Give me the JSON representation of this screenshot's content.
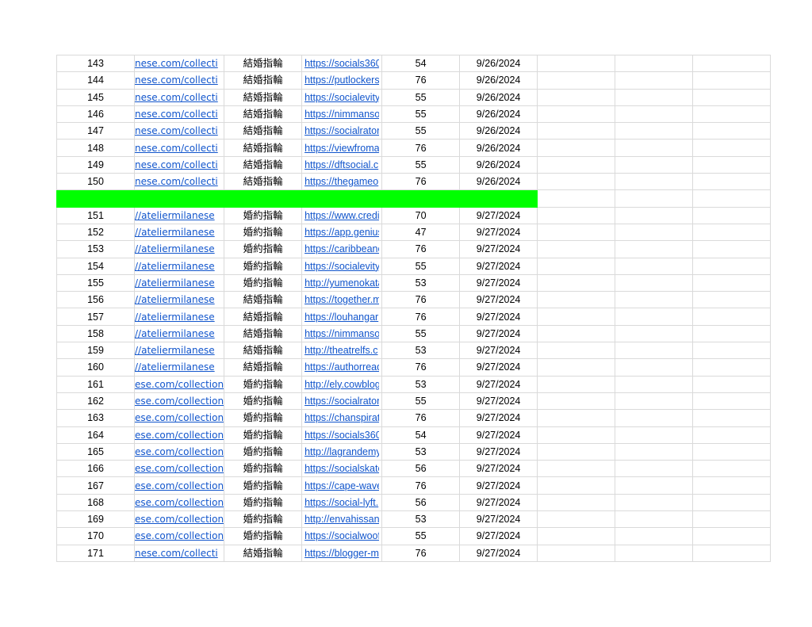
{
  "rows": [
    {
      "num": "143",
      "src": "nese.com/collecti",
      "kw": "結婚指輪",
      "url": "https://socials360",
      "da": "54",
      "date": "9/26/2024"
    },
    {
      "num": "144",
      "src": "nese.com/collecti",
      "kw": "結婚指輪",
      "url": "https://putlockers",
      "da": "76",
      "date": "9/26/2024"
    },
    {
      "num": "145",
      "src": "nese.com/collecti",
      "kw": "結婚指輪",
      "url": "https://socialevity",
      "da": "55",
      "date": "9/26/2024"
    },
    {
      "num": "146",
      "src": "nese.com/collecti",
      "kw": "結婚指輪",
      "url": "https://nimmanso",
      "da": "55",
      "date": "9/26/2024"
    },
    {
      "num": "147",
      "src": "nese.com/collecti",
      "kw": "結婚指輪",
      "url": "https://socialrator",
      "da": "55",
      "date": "9/26/2024"
    },
    {
      "num": "148",
      "src": "nese.com/collecti",
      "kw": "結婚指輪",
      "url": "https://viewfroma",
      "da": "76",
      "date": "9/26/2024"
    },
    {
      "num": "149",
      "src": "nese.com/collecti",
      "kw": "結婚指輪",
      "url": "https://dftsocial.c",
      "da": "55",
      "date": "9/26/2024"
    },
    {
      "num": "150",
      "src": "nese.com/collecti",
      "kw": "結婚指輪",
      "url": "https://thegameo",
      "da": "76",
      "date": "9/26/2024"
    },
    {
      "separator": true
    },
    {
      "num": "151",
      "src": "//ateliermilanese",
      "kw": "婚約指輪",
      "url": "https://www.credi",
      "da": "70",
      "date": "9/27/2024"
    },
    {
      "num": "152",
      "src": "//ateliermilanese",
      "kw": "婚約指輪",
      "url": "https://app.genius",
      "da": "47",
      "date": "9/27/2024"
    },
    {
      "num": "153",
      "src": "//ateliermilanese",
      "kw": "婚約指輪",
      "url": "https://caribbeanc",
      "da": "76",
      "date": "9/27/2024"
    },
    {
      "num": "154",
      "src": "//ateliermilanese",
      "kw": "婚約指輪",
      "url": "https://socialevity",
      "da": "55",
      "date": "9/27/2024"
    },
    {
      "num": "155",
      "src": "//ateliermilanese",
      "kw": "婚約指輪",
      "url": "http://yumenokata",
      "da": "53",
      "date": "9/27/2024"
    },
    {
      "num": "156",
      "src": "//ateliermilanese",
      "kw": "結婚指輪",
      "url": "https://together.m",
      "da": "76",
      "date": "9/27/2024"
    },
    {
      "num": "157",
      "src": "//ateliermilanese",
      "kw": "結婚指輪",
      "url": "https://louhangar",
      "da": "76",
      "date": "9/27/2024"
    },
    {
      "num": "158",
      "src": "//ateliermilanese",
      "kw": "結婚指輪",
      "url": "https://nimmanso",
      "da": "55",
      "date": "9/27/2024"
    },
    {
      "num": "159",
      "src": "//ateliermilanese",
      "kw": "結婚指輪",
      "url": "http://theatrelfs.c",
      "da": "53",
      "date": "9/27/2024"
    },
    {
      "num": "160",
      "src": "//ateliermilanese",
      "kw": "結婚指輪",
      "url": "https://authorread",
      "da": "76",
      "date": "9/27/2024"
    },
    {
      "num": "161",
      "src": "ese.com/collection",
      "kw": "婚約指輪",
      "url": "http://ely.cowblog",
      "da": "53",
      "date": "9/27/2024"
    },
    {
      "num": "162",
      "src": "ese.com/collection",
      "kw": "婚約指輪",
      "url": "https://socialrator",
      "da": "55",
      "date": "9/27/2024"
    },
    {
      "num": "163",
      "src": "ese.com/collection",
      "kw": "婚約指輪",
      "url": "https://chanspirat",
      "da": "76",
      "date": "9/27/2024"
    },
    {
      "num": "164",
      "src": "ese.com/collection",
      "kw": "婚約指輪",
      "url": "https://socials360",
      "da": "54",
      "date": "9/27/2024"
    },
    {
      "num": "165",
      "src": "ese.com/collection",
      "kw": "婚約指輪",
      "url": "http://lagrandemy",
      "da": "53",
      "date": "9/27/2024"
    },
    {
      "num": "166",
      "src": "ese.com/collection",
      "kw": "婚約指輪",
      "url": "https://socialskate",
      "da": "56",
      "date": "9/27/2024"
    },
    {
      "num": "167",
      "src": "ese.com/collection",
      "kw": "婚約指輪",
      "url": "https://cape-wave",
      "da": "76",
      "date": "9/27/2024"
    },
    {
      "num": "168",
      "src": "ese.com/collection",
      "kw": "婚約指輪",
      "url": "https://social-lyft.",
      "da": "56",
      "date": "9/27/2024"
    },
    {
      "num": "169",
      "src": "ese.com/collection",
      "kw": "婚約指輪",
      "url": "http://envahissan",
      "da": "53",
      "date": "9/27/2024"
    },
    {
      "num": "170",
      "src": "ese.com/collection",
      "kw": "婚約指輪",
      "url": "https://socialwoof",
      "da": "55",
      "date": "9/27/2024"
    },
    {
      "num": "171",
      "src": "nese.com/collecti",
      "kw": "結婚指輪",
      "url": "https://blogger-m",
      "da": "76",
      "date": "9/27/2024"
    }
  ],
  "colors": {
    "separator": "#00ff00",
    "link": "#1155cc",
    "grid": "#dadada"
  }
}
